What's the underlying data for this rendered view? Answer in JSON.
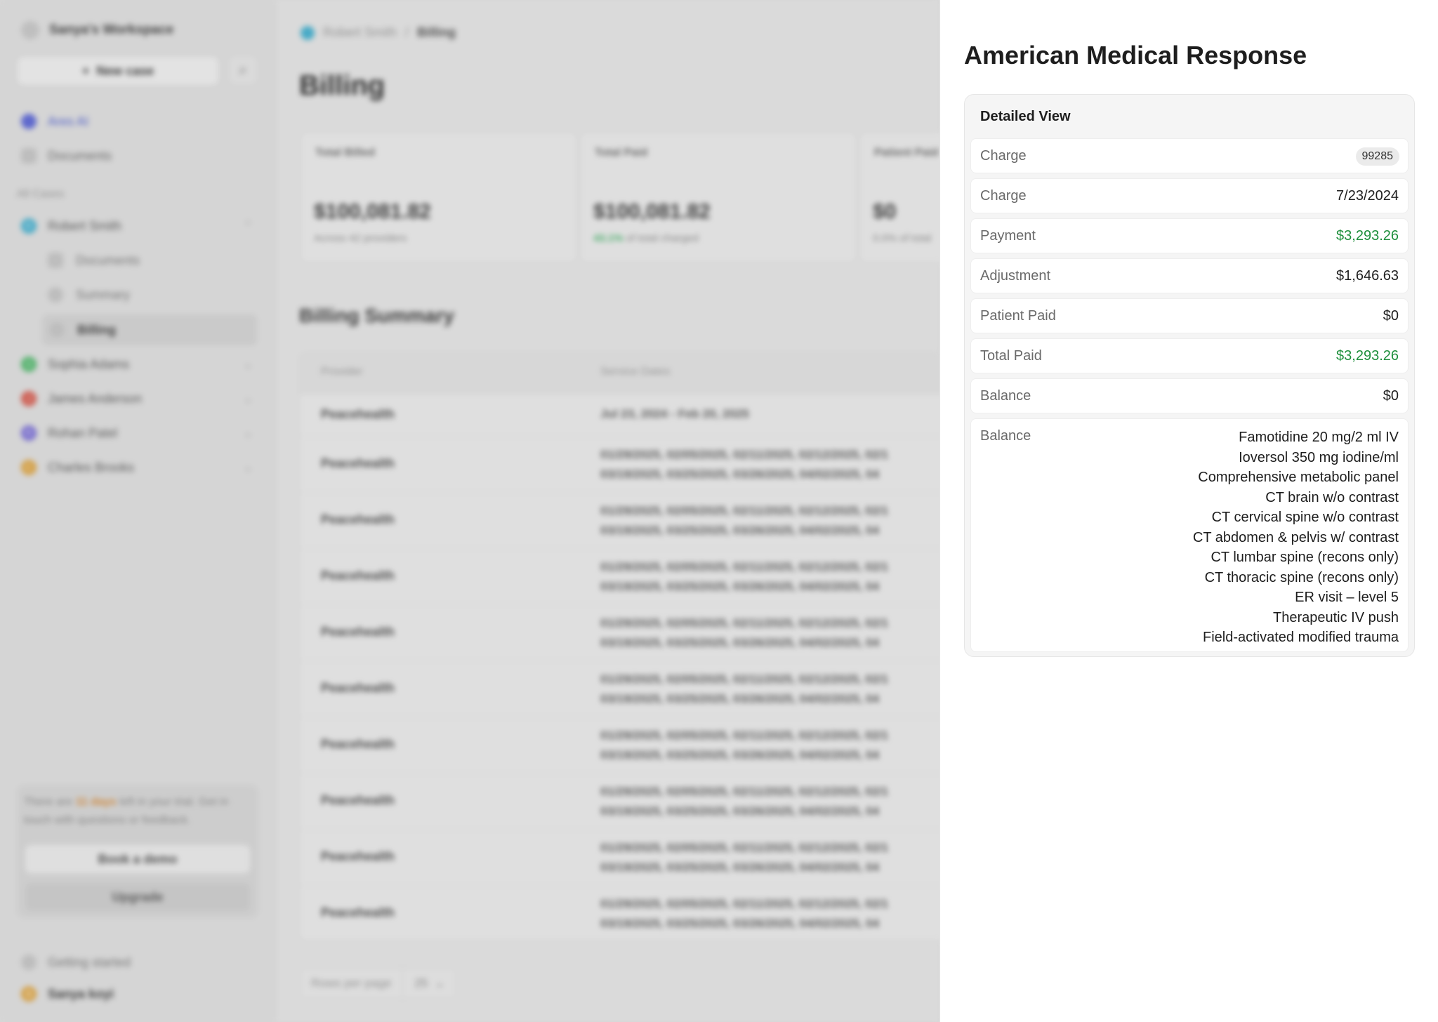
{
  "sidebar": {
    "workspace_name": "Sanya's Workspace",
    "new_case_label": "New case",
    "nav": [
      {
        "label": "Ares AI"
      },
      {
        "label": "Documents"
      }
    ],
    "section_label": "All Cases",
    "cases": [
      {
        "initial": "R",
        "name": "Robert Smith",
        "color": "#3fb6d8"
      },
      {
        "initial": "S",
        "name": "Sophia Adams",
        "color": "#4cbf6a"
      },
      {
        "initial": "J",
        "name": "James Anderson",
        "color": "#e05a4c"
      },
      {
        "initial": "R",
        "name": "Rohan Patel",
        "color": "#7a6de0"
      },
      {
        "initial": "C",
        "name": "Charles Brooks",
        "color": "#e9a93b"
      }
    ],
    "sub_items": [
      "Documents",
      "Summary",
      "Billing"
    ],
    "trial": {
      "prefix": "There are ",
      "days": "11 days",
      "suffix": " left in your trial. Get in touch with questions or feedback."
    },
    "book_demo_label": "Book a demo",
    "upgrade_label": "Upgrade",
    "getting_started_label": "Getting started",
    "user_name": "Sanya koyi"
  },
  "main": {
    "breadcrumb": {
      "case": "Robert Smith",
      "separator": "/",
      "current": "Billing"
    },
    "title": "Billing",
    "stats": [
      {
        "label": "Total Billed",
        "value": "$100,081.82",
        "note": "Across 42 providers",
        "pct": ""
      },
      {
        "label": "Total Paid",
        "value": "$100,081.82",
        "note": " of total charged",
        "pct": "43.1%"
      },
      {
        "label": "Patient Paid",
        "value": "$0",
        "note": "0.0% of total",
        "pct": ""
      }
    ],
    "summary_title": "Billing Summary",
    "table": {
      "headers": [
        "Provider",
        "Service Dates"
      ],
      "rows": [
        {
          "provider": "Peacehealth",
          "line1": "Jul 23, 2024 - Feb 20, 2025",
          "line2": ""
        },
        {
          "provider": "Peacehealth",
          "line1": "01/29/2025, 02/05/2025, 02/11/2025, 02/12/2025, 02/1",
          "line2": "03/19/2025, 03/25/2025, 03/26/2025, 04/02/2025, 04"
        },
        {
          "provider": "Peacehealth",
          "line1": "01/29/2025, 02/05/2025, 02/11/2025, 02/12/2025, 02/1",
          "line2": "03/19/2025, 03/25/2025, 03/26/2025, 04/02/2025, 04"
        },
        {
          "provider": "Peacehealth",
          "line1": "01/29/2025, 02/05/2025, 02/11/2025, 02/12/2025, 02/1",
          "line2": "03/19/2025, 03/25/2025, 03/26/2025, 04/02/2025, 04"
        },
        {
          "provider": "Peacehealth",
          "line1": "01/29/2025, 02/05/2025, 02/11/2025, 02/12/2025, 02/1",
          "line2": "03/19/2025, 03/25/2025, 03/26/2025, 04/02/2025, 04"
        },
        {
          "provider": "Peacehealth",
          "line1": "01/29/2025, 02/05/2025, 02/11/2025, 02/12/2025, 02/1",
          "line2": "03/19/2025, 03/25/2025, 03/26/2025, 04/02/2025, 04"
        },
        {
          "provider": "Peacehealth",
          "line1": "01/29/2025, 02/05/2025, 02/11/2025, 02/12/2025, 02/1",
          "line2": "03/19/2025, 03/25/2025, 03/26/2025, 04/02/2025, 04"
        },
        {
          "provider": "Peacehealth",
          "line1": "01/29/2025, 02/05/2025, 02/11/2025, 02/12/2025, 02/1",
          "line2": "03/19/2025, 03/25/2025, 03/26/2025, 04/02/2025, 04"
        },
        {
          "provider": "Peacehealth",
          "line1": "01/29/2025, 02/05/2025, 02/11/2025, 02/12/2025, 02/1",
          "line2": "03/19/2025, 03/25/2025, 03/26/2025, 04/02/2025, 04"
        },
        {
          "provider": "Peacehealth",
          "line1": "01/29/2025, 02/05/2025, 02/11/2025, 02/12/2025, 02/1",
          "line2": "03/19/2025, 03/25/2025, 03/26/2025, 04/02/2025, 04"
        }
      ]
    },
    "rows_per_page_label": "Rows per page",
    "rows_per_page_value": "25"
  },
  "panel": {
    "title": "American Medical Response",
    "detail_heading": "Detailed View",
    "rows": [
      {
        "label": "Charge",
        "badge": "99285"
      },
      {
        "label": "Charge",
        "value": "7/23/2024"
      },
      {
        "label": "Payment",
        "value": "$3,293.26",
        "tone": "green"
      },
      {
        "label": "Adjustment",
        "value": "$1,646.63"
      },
      {
        "label": "Patient Paid",
        "value": "$0"
      },
      {
        "label": "Total Paid",
        "value": "$3,293.26",
        "tone": "green"
      },
      {
        "label": "Balance",
        "value": "$0"
      }
    ],
    "list_label": "Balance",
    "list_items": [
      "Famotidine 20 mg/2 ml IV",
      "Ioversol 350 mg iodine/ml",
      "Comprehensive metabolic panel",
      "CT brain w/o contrast",
      "CT cervical spine w/o contrast",
      "CT abdomen & pelvis w/ contrast",
      "CT lumbar spine (recons only)",
      "CT thoracic spine (recons only)",
      "ER visit – level 5",
      "Therapeutic IV push",
      "Field-activated modified trauma"
    ],
    "colors": {
      "green": "#1e8f3c"
    }
  }
}
